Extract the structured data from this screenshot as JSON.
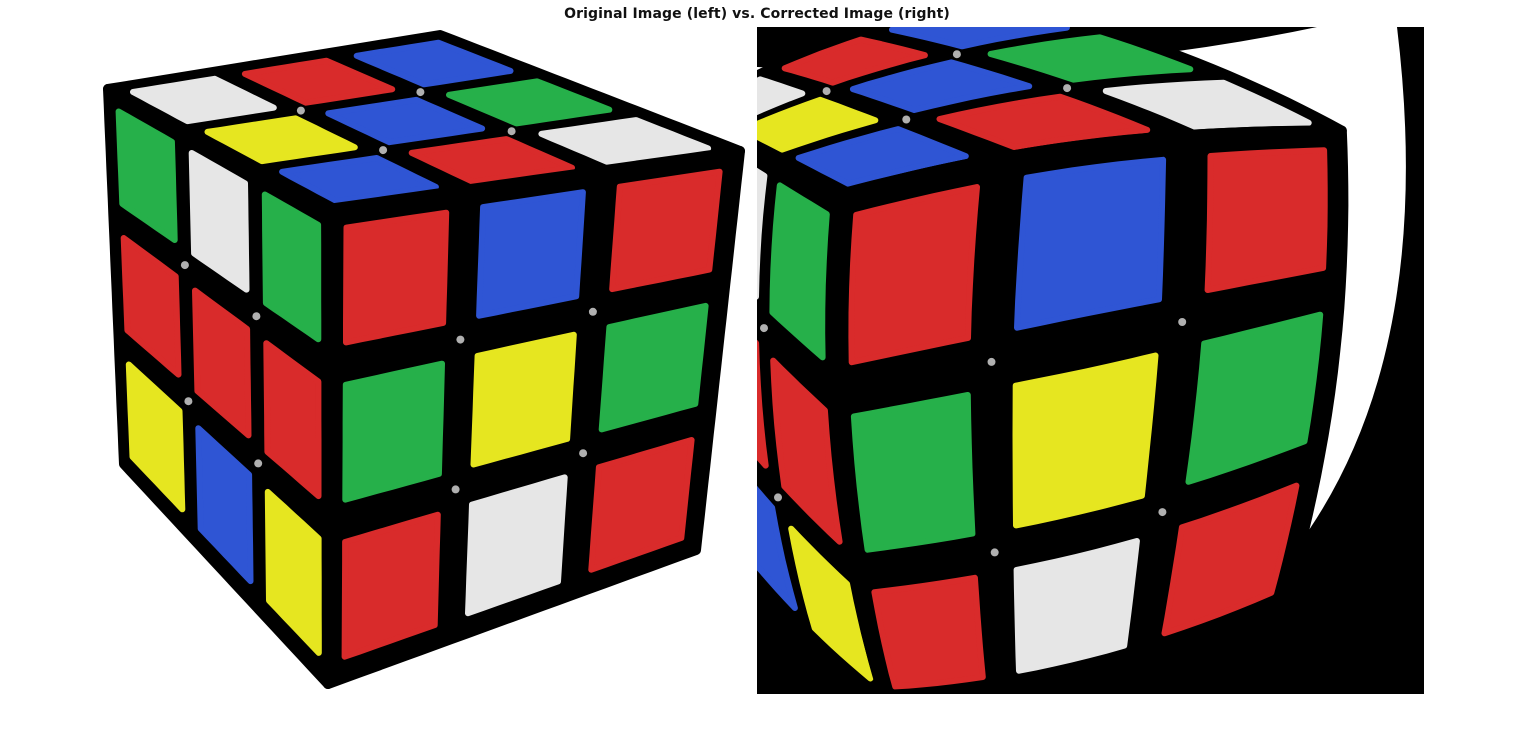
{
  "figure": {
    "title": "Original Image (left) vs. Corrected Image (right)"
  },
  "panels": [
    {
      "id": "left",
      "role": "original-image"
    },
    {
      "id": "right",
      "role": "corrected-image"
    }
  ],
  "colors": {
    "red": "#d92b2b",
    "blue": "#2f55d4",
    "green": "#26b04a",
    "yellow": "#e6e620",
    "white": "#e6e6e6",
    "outline": "#000000",
    "corrected_background": "#000000"
  },
  "cube_faces": {
    "top": [
      [
        "white",
        "red",
        "blue"
      ],
      [
        "yellow",
        "blue",
        "green"
      ],
      [
        "blue",
        "red",
        "white"
      ]
    ],
    "left": [
      [
        "green",
        "white",
        "green"
      ],
      [
        "red",
        "red",
        "red"
      ],
      [
        "yellow",
        "blue",
        "yellow"
      ]
    ],
    "right": [
      [
        "red",
        "blue",
        "red"
      ],
      [
        "green",
        "yellow",
        "green"
      ],
      [
        "red",
        "white",
        "red"
      ]
    ]
  }
}
